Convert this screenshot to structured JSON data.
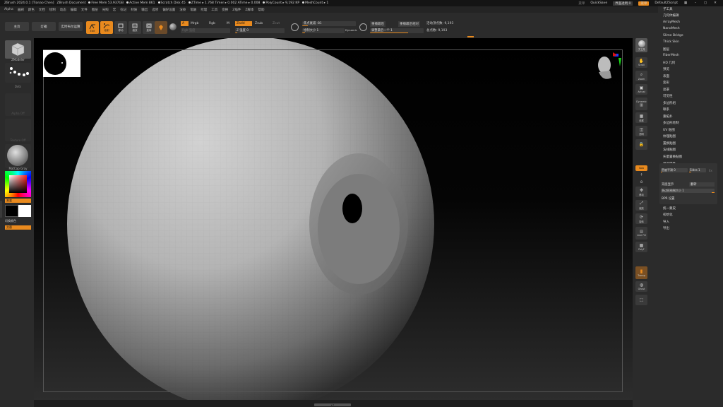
{
  "titlebar": {
    "items": [
      "ZBrush 2024.0.1 [Tianao Chen]",
      "ZBrush Document",
      "Free Mem 53.937GB",
      "Active Mem 861",
      "Scratch Disk 45",
      "ZTime ▸ 1.768 Timer ▸ 0.002 ATime ▸ 0.008",
      "PolyCount ▸ 9,192 KP",
      "MeshCount ▸ 1"
    ],
    "menu_label": "菜单",
    "quicksave": "QuickSave",
    "transparency": "界面透明 0",
    "menus_btn": "菜单",
    "script": "DefaultZScript"
  },
  "menubar": {
    "items": [
      "Alpha",
      "画刷",
      "颜色",
      "文档",
      "绘制",
      "动态",
      "编辑",
      "文件",
      "图层",
      "光照",
      "宏",
      "标记",
      "材质",
      "输出",
      "选项",
      "偏好设置",
      "渲染",
      "笔触",
      "纹理",
      "工具",
      "变换",
      "Z插件",
      "Z脚本",
      "帮助"
    ]
  },
  "toolbar": {
    "home": "主页",
    "lightbox": "灯箱",
    "live_boolean": "实时布尔运算",
    "edit": "Edit",
    "draw": "绘制",
    "move": "移动",
    "scale": "缩放",
    "rotate": "旋转",
    "a": "A",
    "mrgb": "Mrgb",
    "rgb": "Rgb",
    "m": "M",
    "zadd": "Zadd",
    "zsub": "Zsub",
    "zcut": "Zcut",
    "rgb_intensity": "Rgb 强度",
    "z_intensity": "Z 强度 0",
    "focal_shift": "焦点衰减 -81",
    "draw_size": "绘制大小 1",
    "dynamic": "Dynamic",
    "replay_last": "重播最后",
    "replay_last_rel": "重播最后相对",
    "adjust_last": "调整最后一个 1",
    "active_points": "活动顶点数: 9,193",
    "total_points": "总点数: 9,193"
  },
  "leftpanel": {
    "zmodeler": "ZModeler",
    "dots": "Dots",
    "alpha_off": "Alpha Off",
    "texture_off": "Texture Off",
    "matcap": "MatCap Gray",
    "gradient": "渐变",
    "switch_color": "切换颜色",
    "alternate": "交替"
  },
  "rightshelf": {
    "items": [
      "子工具",
      "Scroll",
      "Zoom",
      "Actual",
      "Dynamic",
      "线框",
      "透明",
      "Solo",
      "选择",
      "移动",
      "缩放",
      "旋转",
      "Line Fill",
      "PolyF",
      "Transp",
      "Ghost"
    ],
    "solo": "Solo"
  },
  "toolpalette": {
    "items": [
      "子工具",
      "几何体编辑",
      "ArrayMesh",
      "NanoMesh",
      "Slime Bridge",
      "Thick Skin",
      "图层",
      "FiberMesh",
      "HD 几何",
      "预览",
      "表面",
      "变形",
      "遮罩",
      "可见性",
      "多边形组",
      "联系",
      "重拓扑",
      "多边形绘制",
      "UV 贴图",
      "纹理贴图",
      "置换贴图",
      "法线贴图",
      "矢量置换贴图",
      "显示属性"
    ],
    "bottom_items": [
      "统一蒙皮",
      "初始化",
      "导入",
      "导出"
    ],
    "subpanel": {
      "density": "密度平滑 0",
      "sides": "Sides 1",
      "sides_label": "Ex",
      "double_sided": "双面显示",
      "flip": "翻转",
      "poly_size": "多边形绘制大小 1",
      "bpr": "BPR 设置"
    }
  },
  "bottombar": {
    "label": "▴ ▾"
  },
  "colors": {
    "accent": "#e98a1e",
    "panel": "#2b2b2b",
    "canvas": "#000000"
  }
}
